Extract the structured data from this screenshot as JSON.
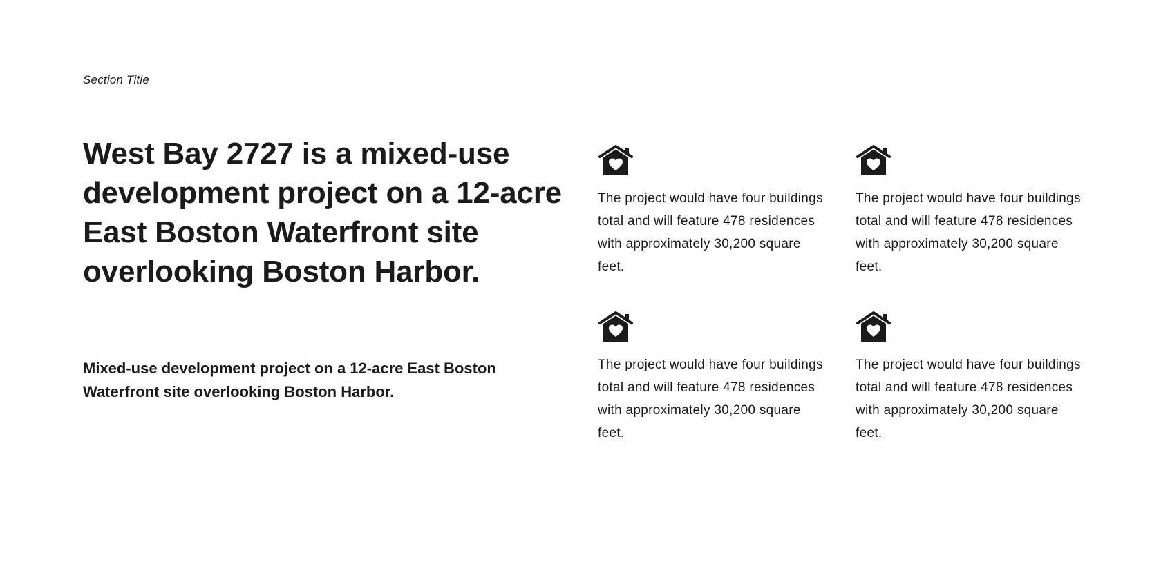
{
  "section": {
    "title": "Section Title"
  },
  "hero": {
    "headline": "West Bay 2727 is a mixed-use development project on a 12-acre East Boston Waterfront site overlooking Boston Harbor.",
    "subhead": "Mixed-use development project on a 12-acre East Boston Waterfront site overlooking Boston Harbor."
  },
  "features": [
    {
      "icon": "home-heart-icon",
      "text": "The project would have four buildings total and will feature 478 residences with approximately 30,200 square feet."
    },
    {
      "icon": "home-heart-icon",
      "text": "The project would have four buildings total and will feature 478 residences with approximately 30,200 square feet."
    },
    {
      "icon": "home-heart-icon",
      "text": "The project would have four buildings total and will feature 478 residences with approximately 30,200 square feet."
    },
    {
      "icon": "home-heart-icon",
      "text": "The project would have four buildings total and will feature 478 residences with approximately 30,200 square feet."
    }
  ],
  "colors": {
    "text": "#1b1b1b",
    "background": "#ffffff"
  }
}
